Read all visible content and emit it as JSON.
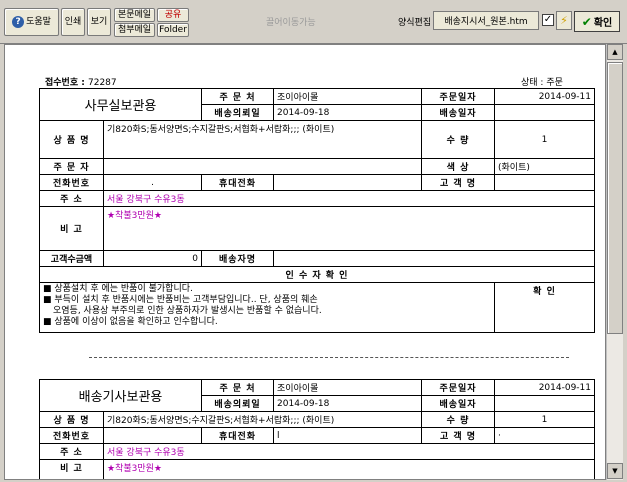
{
  "toolbar": {
    "help": "도움말",
    "print": "인쇄",
    "view": "보기",
    "body_mail": "본문메일",
    "share": "공유",
    "attach_mail": "첨부메일",
    "folder": "Folder",
    "drag_hint": "끌어이동가능",
    "template_label": "양식편집",
    "template_value": "배송지시서_원본.htm",
    "checkbox_mark": "✓",
    "ok": "확인"
  },
  "doc": {
    "receipt_label": "접수번호 :",
    "receipt_no": "72287",
    "state_label": "상태 :",
    "state_value": "주문",
    "notice_line1": "■ 상품설치 후 에는 반품이 불가합니다.",
    "notice_line2": "■ 부득이 설치 후 반품시에는 반품비는 고객부담입니다.. 단, 상품의 훼손",
    "notice_line3": "오염등, 사용상 부주의로 인한 상품하자가 발생시는 반품할 수 없습니다.",
    "notice_line4": "■ 상품에 이상이 없음을 확인하고 인수합니다.",
    "confirm": "확 인",
    "receiver_confirm": "인 수 자 확 인"
  },
  "labels": {
    "orderer_place": "주 문 처",
    "order_date": "주문일자",
    "delivery_request_date": "배송의뢰일",
    "delivery_date": "배송일자",
    "product_name": "상 품 명",
    "quantity": "수 량",
    "orderer": "주 문 자",
    "color": "색 상",
    "phone": "전화번호",
    "mobile": "휴대전화",
    "customer_name": "고 객 명",
    "address": "주 소",
    "remark": "비 고",
    "customer_amount": "고객수금액",
    "deliverer": "배송자명"
  },
  "form1": {
    "title": "사무실보관용",
    "orderer_place": "조이아이몰",
    "order_date": "2014-09-11",
    "delivery_request_date": "2014-09-18",
    "product": "기820화S;동서양면S;수지갈판S;서협화+서랍화;;; (화이트)",
    "quantity": "1",
    "color": "(화이트)",
    "phone": ".",
    "address": "서울 강북구 수유3동",
    "remark": "★착불3만원★",
    "amount": "0"
  },
  "form2": {
    "title": "배송기사보관용",
    "orderer_place": "조이아이몰",
    "order_date": "2014-09-11",
    "delivery_request_date": "2014-09-18",
    "product": "기820화S;동서양면S;수지갈판S;서협화+서랍화;;; (화이트)",
    "quantity": "1",
    "mobile": "l",
    "customer_name": "·",
    "address": "서울 강북구 수유3동",
    "remark": "★착불3만원★"
  }
}
